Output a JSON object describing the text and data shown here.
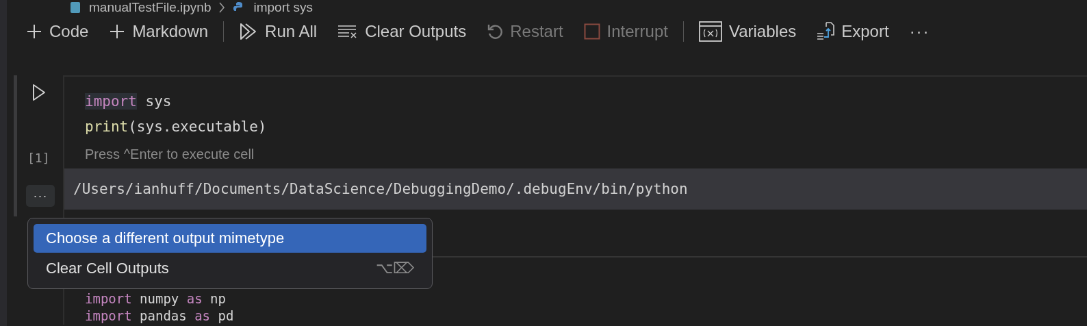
{
  "breadcrumb": [
    {
      "kind": "notebook",
      "text": "manualTestFile.ipynb"
    },
    {
      "kind": "python",
      "text": "import sys"
    }
  ],
  "toolbar": [
    {
      "kind": "code",
      "label": "Code",
      "disabled": false
    },
    {
      "kind": "markdown",
      "label": "Markdown",
      "disabled": false
    },
    {
      "kind": "separator"
    },
    {
      "kind": "run-all",
      "label": "Run All",
      "disabled": false
    },
    {
      "kind": "clear",
      "label": "Clear Outputs",
      "disabled": false
    },
    {
      "kind": "restart",
      "label": "Restart",
      "disabled": true
    },
    {
      "kind": "interrupt",
      "label": "Interrupt",
      "disabled": true
    },
    {
      "kind": "separator"
    },
    {
      "kind": "variables",
      "label": "Variables",
      "disabled": false
    },
    {
      "kind": "export",
      "label": "Export",
      "disabled": false
    },
    {
      "kind": "more",
      "label": "···",
      "disabled": false
    }
  ],
  "cells": [
    {
      "execution_count": "[1]",
      "hint": "Press ^Enter to execute cell",
      "output": "/Users/ianhuff/Documents/DataScience/DebuggingDemo/.debugEnv/bin/python",
      "output_menu": "···",
      "lines": [
        [
          {
            "kind": "keyword",
            "text": "import",
            "highlighted": true
          },
          {
            "kind": "plain",
            "text": " sys",
            "highlighted": false
          }
        ],
        [
          {
            "kind": "function",
            "text": "print",
            "highlighted": false
          },
          {
            "kind": "plain",
            "text": "(sys.executable)",
            "highlighted": false
          }
        ]
      ]
    },
    {
      "lines": [
        [
          {
            "kind": "keyword",
            "text": "import",
            "highlighted": false
          },
          {
            "kind": "plain",
            "text": " numpy ",
            "highlighted": false
          },
          {
            "kind": "keyword",
            "text": "as",
            "highlighted": false
          },
          {
            "kind": "plain",
            "text": " np",
            "highlighted": false
          }
        ],
        [
          {
            "kind": "keyword",
            "text": "import",
            "highlighted": false
          },
          {
            "kind": "plain",
            "text": " pandas ",
            "highlighted": false
          },
          {
            "kind": "keyword",
            "text": "as",
            "highlighted": false
          },
          {
            "kind": "plain",
            "text": " pd",
            "highlighted": false
          }
        ]
      ]
    }
  ],
  "context_menu": {
    "items": [
      {
        "label": "Choose a different output mimetype",
        "selected": true
      },
      {
        "label": "Clear Cell Outputs",
        "shortcut": "⌥⌦",
        "selected": false
      }
    ]
  }
}
